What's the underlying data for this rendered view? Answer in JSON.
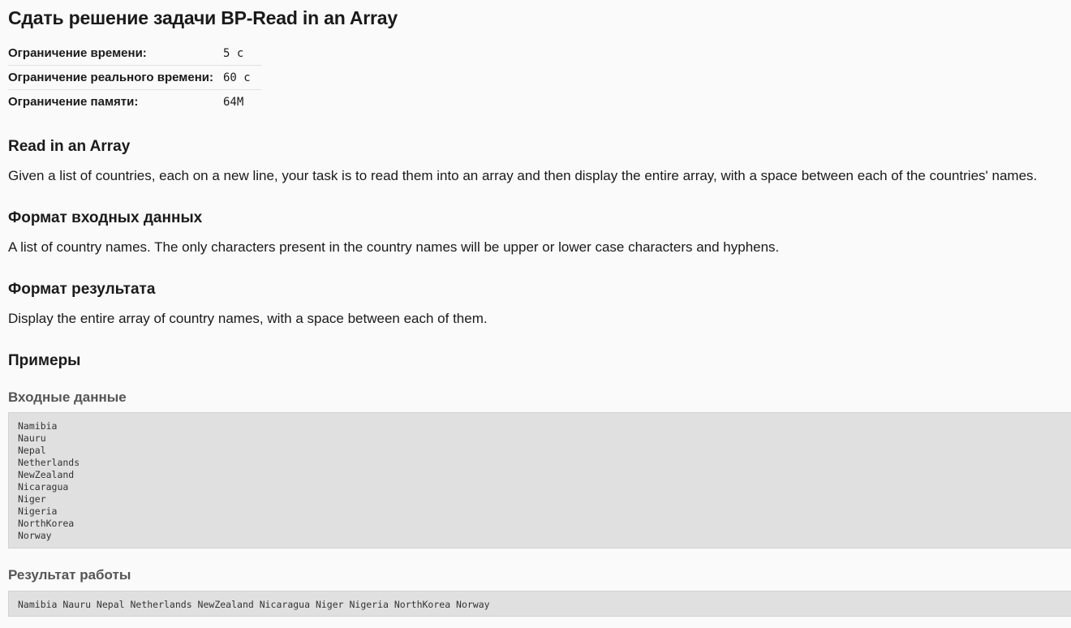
{
  "page": {
    "title": "Сдать решение задачи BP-Read in an Array"
  },
  "limits": [
    {
      "label": "Ограничение времени:",
      "value": "5 с"
    },
    {
      "label": "Ограничение реального времени:",
      "value": "60 с"
    },
    {
      "label": "Ограничение памяти:",
      "value": "64M"
    }
  ],
  "problem": {
    "heading": "Read in an Array",
    "statement": "Given a list of countries, each on a new line, your task is to read them into an array and then display the entire array, with a space between each of the countries' names."
  },
  "input_format": {
    "heading": "Формат входных данных",
    "text": "A list of country names. The only characters present in the country names will be upper or lower case characters and hyphens."
  },
  "output_format": {
    "heading": "Формат результата",
    "text": "Display the entire array of country names, with a space between each of them."
  },
  "examples": {
    "heading": "Примеры",
    "input_label": "Входные данные",
    "input": "Namibia\nNauru\nNepal\nNetherlands\nNewZealand\nNicaragua\nNiger\nNigeria\nNorthKorea\nNorway",
    "output_label": "Результат работы",
    "output": "Namibia Nauru Nepal Netherlands NewZealand Nicaragua Niger Nigeria NorthKorea Norway"
  }
}
